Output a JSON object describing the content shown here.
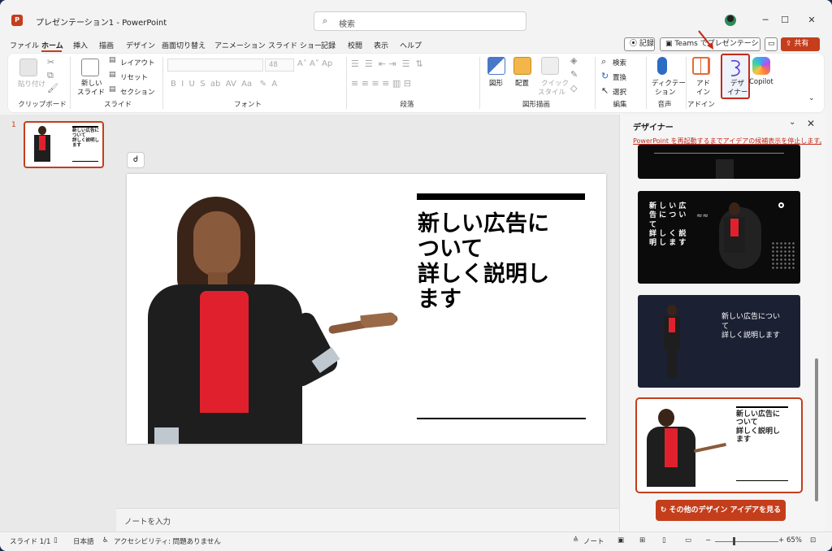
{
  "titlebar": {
    "app_icon": "powerpoint-icon",
    "doc_title": "プレゼンテーション1 - PowerPoint",
    "search_placeholder": "検索"
  },
  "tabs": [
    "ファイル",
    "ホーム",
    "挿入",
    "描画",
    "デザイン",
    "画面切り替え",
    "アニメーション",
    "スライド ショー",
    "記録",
    "校閲",
    "表示",
    "ヘルプ"
  ],
  "active_tab": "ホーム",
  "top_buttons": {
    "record": "記録",
    "teams": "Teams でプレゼンテーション",
    "comment_icon": "comment-icon",
    "share": "共有"
  },
  "ribbon": {
    "clipboard": {
      "paste": "貼り付け",
      "label": "クリップボード"
    },
    "slides": {
      "new_slide_1": "新しい",
      "new_slide_2": "スライド",
      "layout": "レイアウト",
      "reset": "リセット",
      "section": "セクション",
      "label": "スライド"
    },
    "font": {
      "size": "48",
      "label": "フォント"
    },
    "paragraph": {
      "label": "段落"
    },
    "drawing": {
      "shapes": "図形",
      "arrange": "配置",
      "quick_style_1": "クイック",
      "quick_style_2": "スタイル",
      "label": "図形描画"
    },
    "editing": {
      "find": "検索",
      "replace": "置換",
      "select": "選択",
      "label": "編集"
    },
    "voice": {
      "dictate_1": "ディクテー",
      "dictate_2": "ション",
      "label": "音声"
    },
    "addins": {
      "addin_1": "アド",
      "addin_2": "イン",
      "label": "アドイン"
    },
    "designer": {
      "l1": "デザ",
      "l2": "イナー"
    },
    "copilot": "Copilot"
  },
  "thumbs": {
    "number": "1"
  },
  "slide": {
    "title_lines": [
      "新しい広告に",
      "ついて",
      "詳しく説明し",
      "ます"
    ]
  },
  "notes": {
    "placeholder": "ノートを入力"
  },
  "designer_pane": {
    "title": "デザイナー",
    "warning": "PowerPoint を再起動するまでアイデアの候補表示を停止します。",
    "idea2_lines": [
      "新 し い 広",
      "告 に つ い",
      "て",
      "詳 し く 説",
      "明 し ま す"
    ],
    "idea3_lines": [
      "新しい広告につい",
      "て",
      "詳しく説明します"
    ],
    "idea4_lines": [
      "新しい広告に",
      "ついて",
      "詳しく説明し",
      "ます"
    ],
    "more_button": "その他のデザイン アイデアを見る"
  },
  "status": {
    "slide": "スライド 1/1",
    "language": "日本語",
    "accessibility": "アクセシビリティ: 問題ありません",
    "notes": "ノート",
    "zoom": "65%"
  }
}
